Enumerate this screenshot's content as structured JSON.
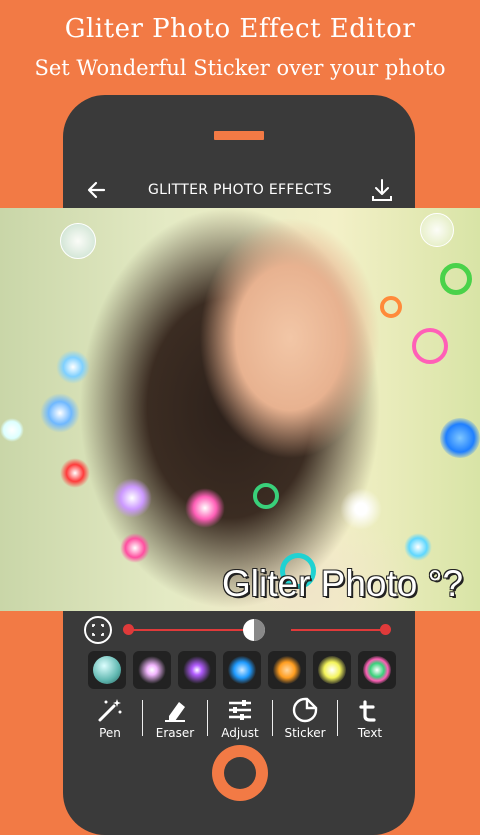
{
  "promo": {
    "title": "Gliter Photo Effect Editor",
    "subtitle": "Set Wonderful Sticker over your photo"
  },
  "appbar": {
    "title": "GLITTER PHOTO EFFECTS",
    "back_icon": "arrow-left-icon",
    "download_icon": "download-icon"
  },
  "photo": {
    "watermark": "Gliter Photo °?"
  },
  "slider": {
    "fit_icon": "fit-screen-icon",
    "contrast_icon": "contrast-icon",
    "left_value": 0,
    "right_value": 1.0
  },
  "effects": [
    {
      "name": "teal-bubble",
      "color": "#5fb7b0"
    },
    {
      "name": "pink-starburst",
      "color": "#f3b6ff"
    },
    {
      "name": "purple-star",
      "color": "#b25cff"
    },
    {
      "name": "blue-snowflake",
      "color": "#1f9bff"
    },
    {
      "name": "orange-snowflake",
      "color": "#ff9d1f"
    },
    {
      "name": "yellow-glow",
      "color": "#f4f45a"
    },
    {
      "name": "green-ring",
      "color": "#39d07a"
    }
  ],
  "toolbar": {
    "items": [
      {
        "label": "Pen",
        "icon": "magic-wand-icon"
      },
      {
        "label": "Eraser",
        "icon": "eraser-icon"
      },
      {
        "label": "Adjust",
        "icon": "sliders-icon"
      },
      {
        "label": "Sticker",
        "icon": "sticker-icon"
      },
      {
        "label": "Text",
        "icon": "text-icon"
      }
    ]
  },
  "colors": {
    "background": "#f27a45",
    "phone": "#3a3a3a",
    "accent": "#e03a3a"
  }
}
